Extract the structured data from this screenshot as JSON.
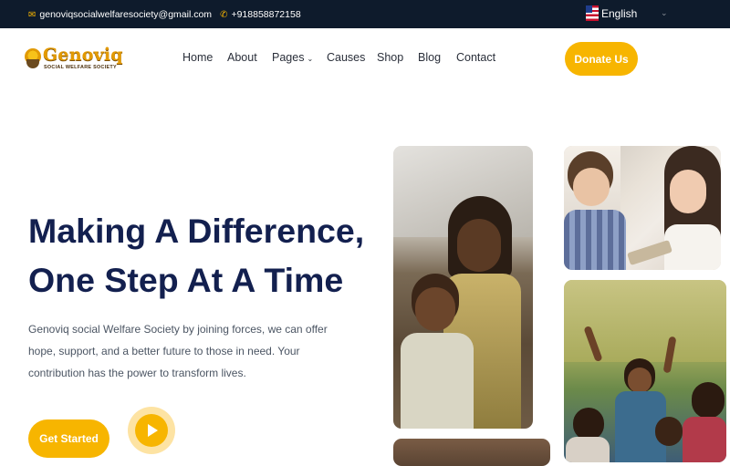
{
  "topbar": {
    "email": "genoviqsocialwelfaresociety@gmail.com",
    "phone": "+918858872158",
    "language": "English",
    "colors": {
      "background": "#0e1b2c",
      "icon_accent": "#f7b500"
    }
  },
  "header": {
    "logo": {
      "brand": "Genoviq",
      "tagline": "SOCIAL WELFARE SOCIETY"
    },
    "nav": [
      {
        "label": "Home"
      },
      {
        "label": "About"
      },
      {
        "label": "Pages",
        "has_dropdown": true
      },
      {
        "label": "Causes"
      },
      {
        "label": "Shop"
      },
      {
        "label": "Blog"
      },
      {
        "label": "Contact"
      }
    ],
    "donate_label": "Donate Us"
  },
  "hero": {
    "title_line1": "Making A Difference,",
    "title_line2": "One Step At A Time",
    "description": "Genoviq social Welfare Society by joining forces, we can offer hope, support, and a better future to those in need. Your contribution has the power to transform lives.",
    "cta_label": "Get Started",
    "colors": {
      "title": "#13204f",
      "accent": "#f7b500"
    }
  },
  "icons": [
    "envelope-icon",
    "phone-icon",
    "us-flag-icon",
    "chevron-down-icon",
    "play-icon"
  ]
}
